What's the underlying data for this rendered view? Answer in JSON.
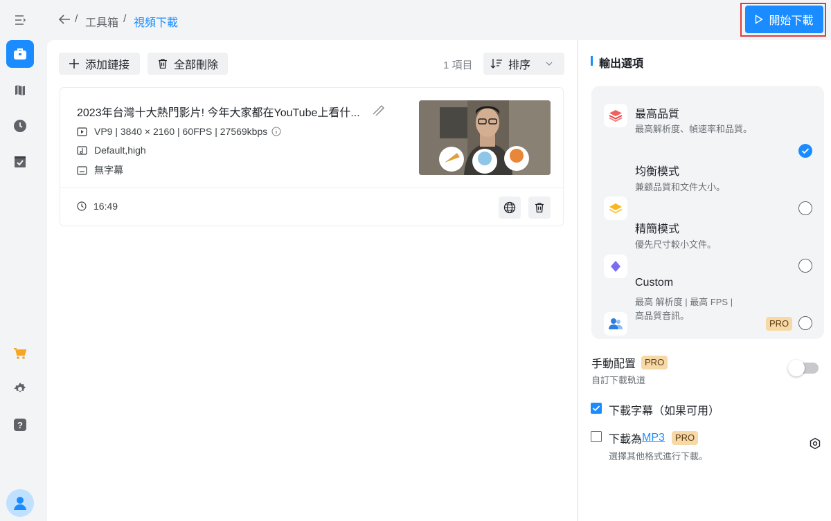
{
  "breadcrumb": {
    "separator": "/",
    "parent": "工具箱",
    "current": "視頻下載"
  },
  "header": {
    "start_label": "開始下載"
  },
  "sidebar": {
    "items": [
      {
        "name": "menu-icon"
      },
      {
        "name": "toolbox-icon",
        "active": true
      },
      {
        "name": "library-icon"
      },
      {
        "name": "history-icon"
      },
      {
        "name": "tasks-icon"
      },
      {
        "name": "cart-icon"
      },
      {
        "name": "gear-icon"
      },
      {
        "name": "help-icon"
      },
      {
        "name": "avatar-icon"
      }
    ]
  },
  "toolbar": {
    "add_label": "添加鏈接",
    "delete_all_label": "全部刪除",
    "item_count": "1 項目",
    "sort_label": "排序"
  },
  "video": {
    "title": "2023年台灣十大熱門影片! 今年大家都在YouTube上看什...",
    "format": "VP9 | 3840 × 2160 | 60FPS | 27569kbps",
    "audio": "Default,high",
    "subtitle": "無字幕",
    "duration": "16:49"
  },
  "output": {
    "section_title": "輸出選項",
    "options": [
      {
        "title": "最高品質",
        "desc": "最高解析度、幀速率和品質。",
        "checked": true,
        "icon": "layers-red-icon"
      },
      {
        "title": "均衡模式",
        "desc": "兼顧品質和文件大小。",
        "checked": false,
        "icon": "layers-yellow-icon"
      },
      {
        "title": "精簡模式",
        "desc": "優先尺寸較小文件。",
        "checked": false,
        "icon": "diamond-purple-icon"
      },
      {
        "title": "Custom",
        "desc_line1": "最高 解析度 | 最高 FPS |",
        "desc_line2": "高品質音訊。",
        "checked": false,
        "pro": "PRO",
        "icon": "users-blue-icon"
      }
    ],
    "manual_config": {
      "title": "手動配置",
      "pro": "PRO",
      "desc": "自訂下載軌道",
      "enabled": false
    },
    "download_subtitle": {
      "label": "下載字幕（如果可用）",
      "checked": true
    },
    "download_mp3": {
      "label_prefix": "下載為",
      "label_link": "MP3",
      "pro": "PRO",
      "desc": "選擇其他格式進行下載。",
      "checked": false
    }
  },
  "colors": {
    "accent": "#1a8cff",
    "pro_badge": "#f7d9a8",
    "highlight_border": "#e03a3a"
  }
}
